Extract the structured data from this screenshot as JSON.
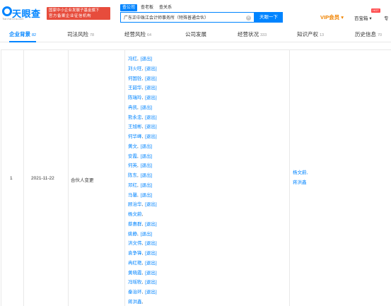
{
  "header": {
    "logo_text": "天眼查",
    "logo_sub": "TianYanCha.com",
    "banner_line1": "国家中小企业发展子基金旗下",
    "banner_line2": "官方备案企业征信机构",
    "search_tabs": [
      "查公司",
      "查老板",
      "查关系"
    ],
    "search_value": "广东正中珠江会计师事务所（特殊普通合伙）",
    "search_button": "天眼一下",
    "vip": "VIP会员",
    "baibao": "百宝箱",
    "hot": "HOT",
    "zhuan": "专",
    "colors": {
      "brand": "#0084ff",
      "banner": "#e74c3c",
      "vip": "#f08300"
    }
  },
  "nav": [
    {
      "label": "企业背景",
      "count": "82",
      "active": true
    },
    {
      "label": "司法风险",
      "count": "78",
      "active": false
    },
    {
      "label": "经营风险",
      "count": "64",
      "active": false
    },
    {
      "label": "公司发展",
      "count": "",
      "active": false
    },
    {
      "label": "经营状况",
      "count": "333",
      "active": false
    },
    {
      "label": "知识产权",
      "count": "13",
      "active": false
    },
    {
      "label": "历史信息",
      "count": "70",
      "active": false
    }
  ],
  "row": {
    "index": "1",
    "date": "2021-11-22",
    "type": "合伙人变更",
    "exit_tag": "[退出]",
    "before": [
      {
        "name": "冯红",
        "exited": true
      },
      {
        "name": "刘火旺",
        "exited": true
      },
      {
        "name": "何国铨",
        "exited": true
      },
      {
        "name": "王韶华",
        "exited": true
      },
      {
        "name": "陈瑞玲",
        "exited": true
      },
      {
        "name": "冉凯",
        "exited": true
      },
      {
        "name": "熊永忠",
        "exited": true
      },
      {
        "name": "王旭彬",
        "exited": true
      },
      {
        "name": "何华峰",
        "exited": true
      },
      {
        "name": "黄文",
        "exited": true
      },
      {
        "name": "安霞",
        "exited": true
      },
      {
        "name": "何英",
        "exited": true
      },
      {
        "name": "陈东",
        "exited": true
      },
      {
        "name": "邓红",
        "exited": true
      },
      {
        "name": "马馨",
        "exited": true
      },
      {
        "name": "顾治华",
        "exited": true
      },
      {
        "name": "杨文蔚",
        "exited": false
      },
      {
        "name": "蔡惠群",
        "exited": true
      },
      {
        "name": "姚静",
        "exited": true
      },
      {
        "name": "洪文伟",
        "exited": true
      },
      {
        "name": "袁争锋",
        "exited": true
      },
      {
        "name": "冉红艳",
        "exited": true
      },
      {
        "name": "黄晓霞",
        "exited": true
      },
      {
        "name": "冯瑶牧",
        "exited": true
      },
      {
        "name": "秦治环",
        "exited": true
      },
      {
        "name": "蒋洪鑫",
        "exited": false
      }
    ],
    "after": [
      "杨文蔚,",
      "蒋洪鑫"
    ]
  }
}
